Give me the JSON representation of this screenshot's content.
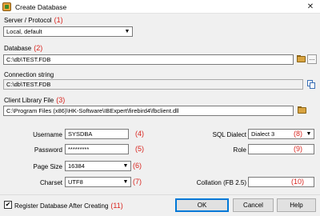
{
  "window": {
    "title": "Create Database",
    "close_glyph": "✕"
  },
  "server_protocol": {
    "label": "Server / Protocol",
    "annotation": "(1)",
    "value": "Local, default"
  },
  "database": {
    "label": "Database",
    "annotation": "(2)",
    "value": "C:\\db\\TEST.FDB",
    "browse_icon": "folder-open-icon",
    "more_label": "..."
  },
  "connection_string": {
    "label": "Connection string",
    "value": "C:\\db\\TEST.FDB",
    "copy_icon": "copy-icon"
  },
  "client_library": {
    "label": "Client Library File",
    "annotation": "(3)",
    "value": "C:\\Program Files (x86)\\HK-Software\\IBExpert\\firebird4\\fbclient.dll",
    "browse_icon": "folder-open-icon"
  },
  "username": {
    "label": "Username",
    "value": "SYSDBA",
    "annotation": "(4)"
  },
  "password": {
    "label": "Password",
    "value": "*********",
    "annotation": "(5)"
  },
  "page_size": {
    "label": "Page Size",
    "value": "16384",
    "annotation": "(6)"
  },
  "charset": {
    "label": "Charset",
    "value": "UTF8",
    "annotation": "(7)"
  },
  "sql_dialect": {
    "label": "SQL Dialect",
    "value": "Dialect 3",
    "annotation": "(8)"
  },
  "role": {
    "label": "Role",
    "value": "",
    "annotation": "(9)"
  },
  "collation": {
    "label": "Collation (FB 2.5)",
    "value": "",
    "annotation": "(10)"
  },
  "register": {
    "label": "Register Database After Creating",
    "checked": true,
    "check_glyph": "✔",
    "annotation": "(11)"
  },
  "buttons": {
    "ok": "OK",
    "cancel": "Cancel",
    "help": "Help"
  },
  "colors": {
    "annotation": "#d9241e",
    "default_button_border": "#0078d7"
  }
}
